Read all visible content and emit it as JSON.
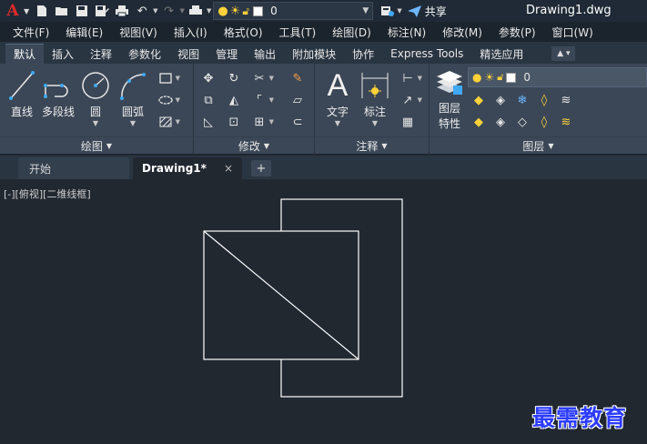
{
  "app": {
    "logo": "A",
    "document_title": "Drawing1.dwg",
    "share_label": "共享",
    "current_layer": "0"
  },
  "menu": [
    "文件(F)",
    "编辑(E)",
    "视图(V)",
    "插入(I)",
    "格式(O)",
    "工具(T)",
    "绘图(D)",
    "标注(N)",
    "修改(M)",
    "参数(P)",
    "窗口(W)"
  ],
  "ribbon_tabs": [
    "默认",
    "插入",
    "注释",
    "参数化",
    "视图",
    "管理",
    "输出",
    "附加模块",
    "协作",
    "Express Tools",
    "精选应用"
  ],
  "active_ribbon_tab": "默认",
  "panels": {
    "draw": {
      "title": "绘图",
      "tools": {
        "line": "直线",
        "polyline": "多段线",
        "circle": "圆",
        "arc": "圆弧"
      }
    },
    "modify": {
      "title": "修改"
    },
    "annotation": {
      "title": "注释",
      "tools": {
        "text": "文字",
        "dimension": "标注"
      }
    },
    "layers": {
      "title": "图层",
      "properties_line1": "图层",
      "properties_line2": "特性",
      "layer_name": "0"
    }
  },
  "doc_tabs": {
    "start": "开始",
    "current": "Drawing1*",
    "close": "×",
    "new": "+"
  },
  "viewport": {
    "label": "[-][俯视][二维线框]"
  },
  "watermark": "最需教育",
  "colors": {
    "background": "#212830",
    "ribbon": "#3b4756",
    "lines": "#ffffff",
    "logo_red": "#e12a2a",
    "watermark_blue": "#2d3cff"
  }
}
